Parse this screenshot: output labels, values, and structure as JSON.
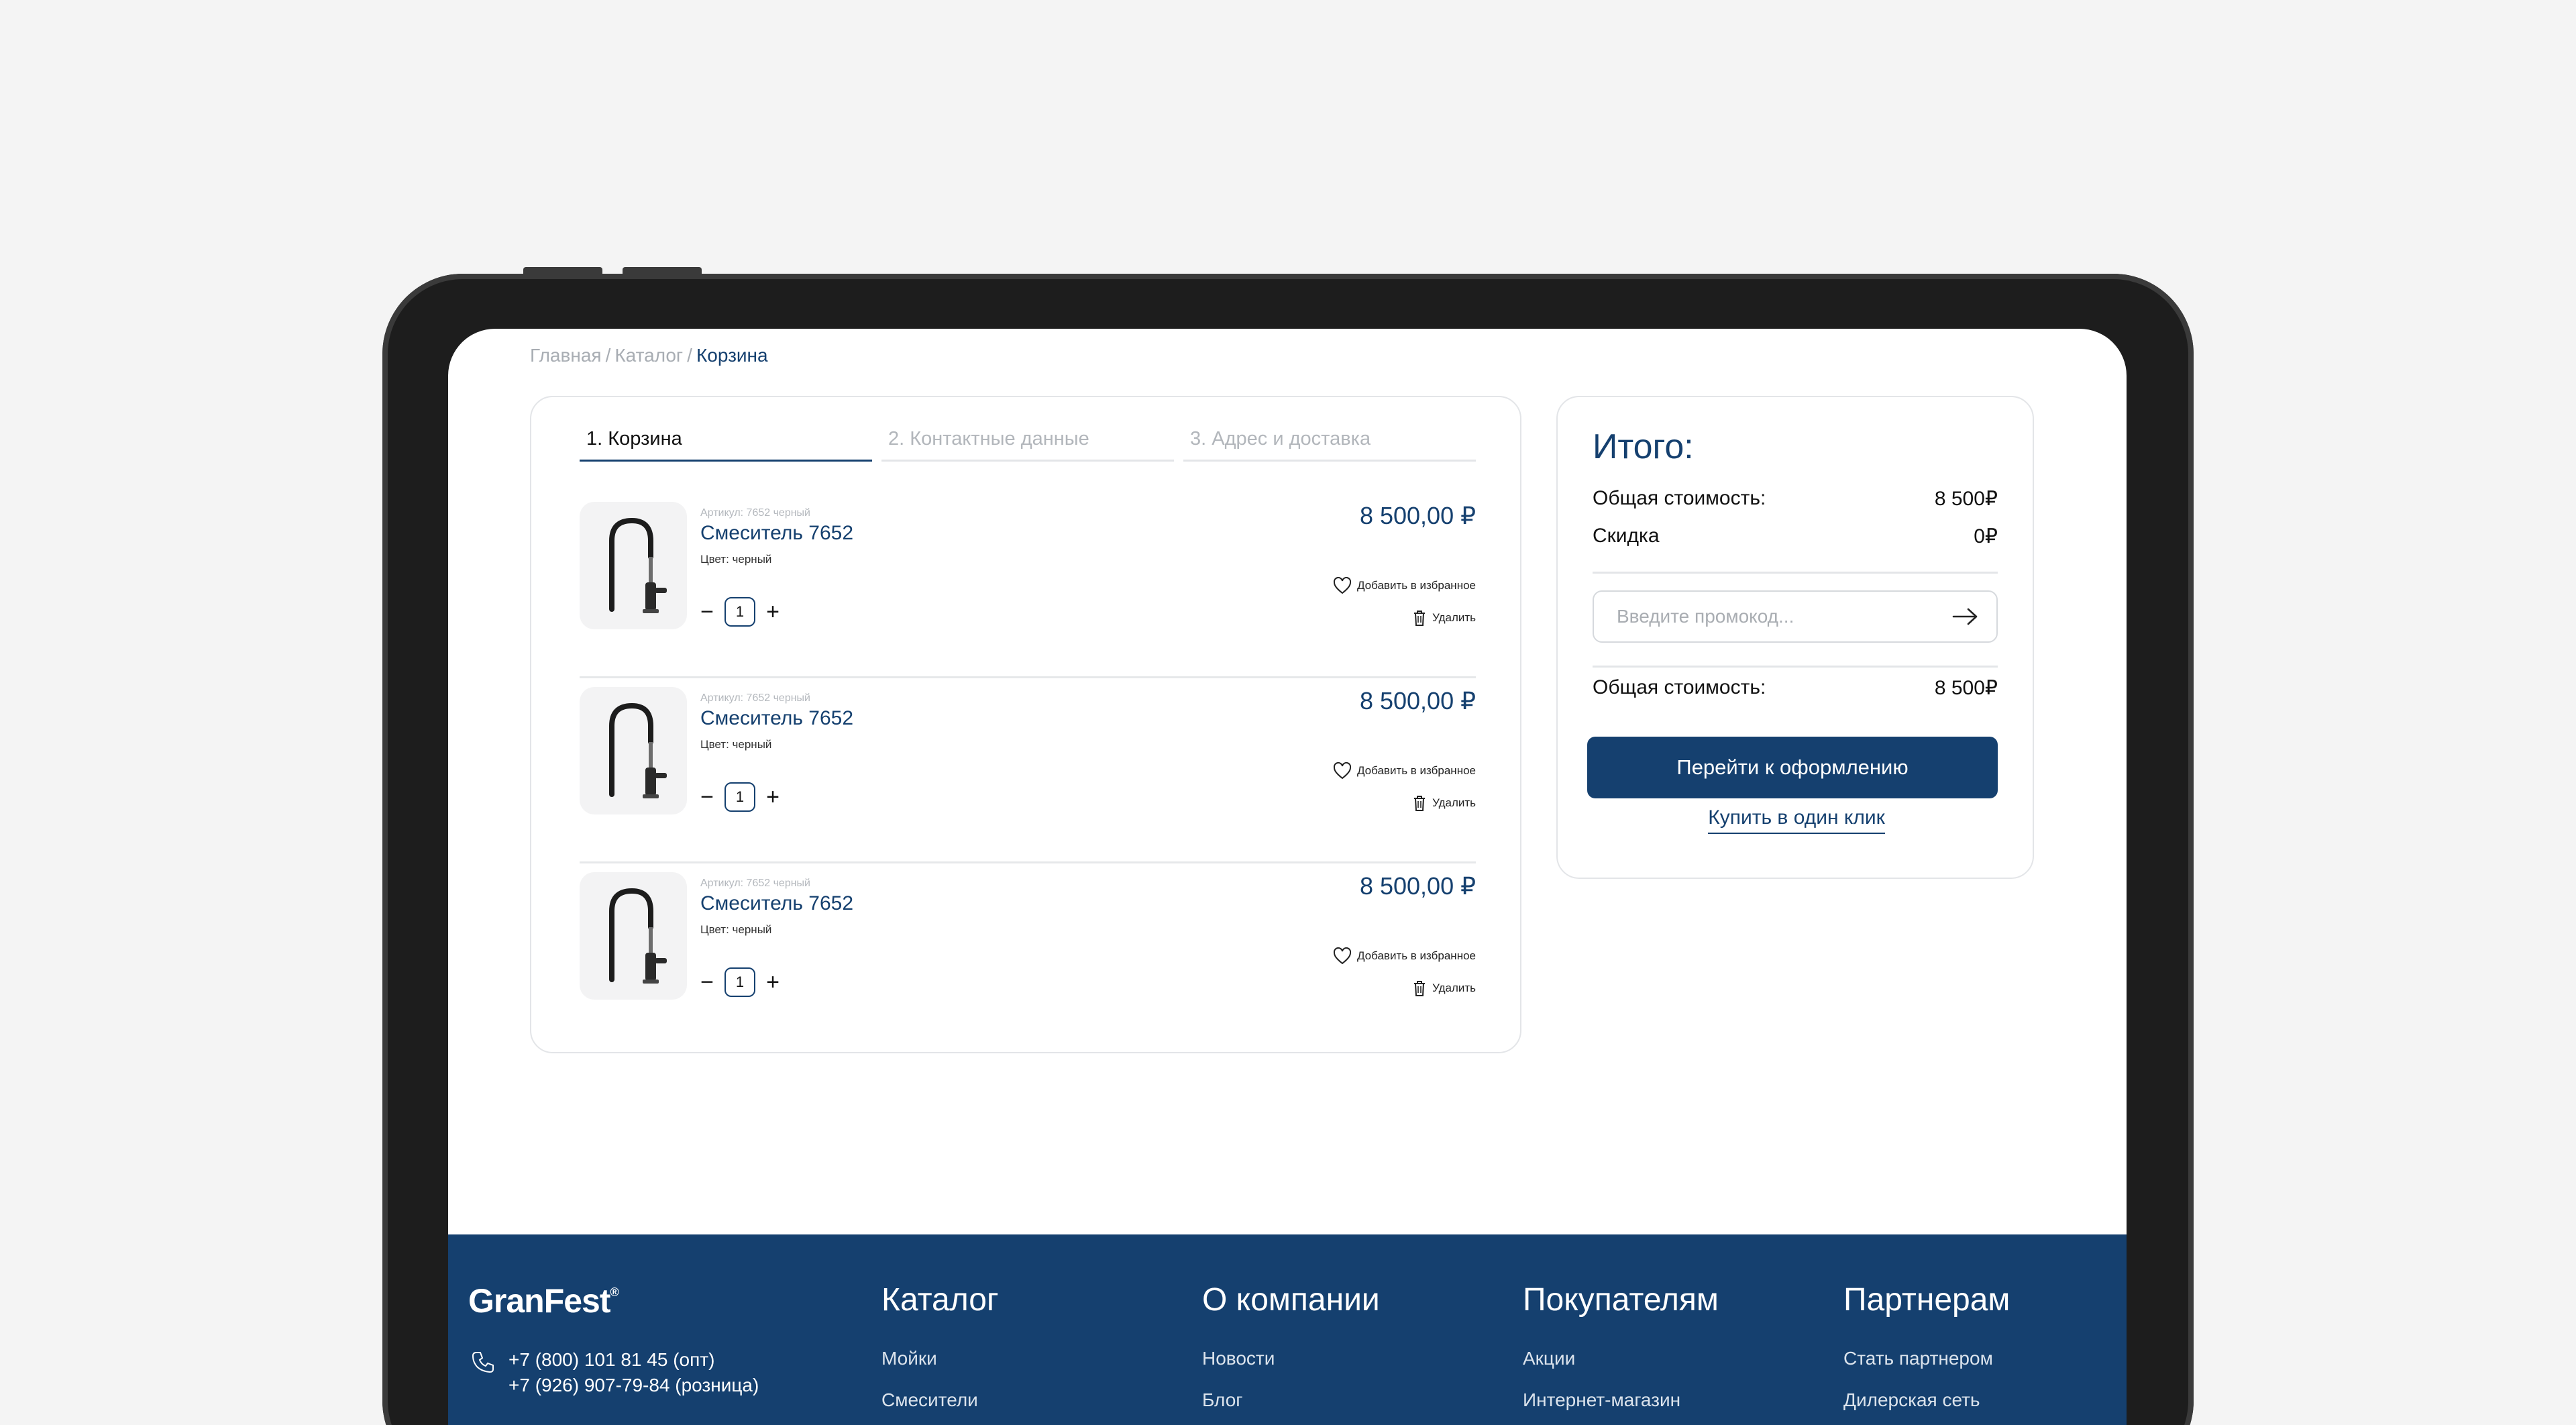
{
  "breadcrumb": {
    "home": "Главная",
    "catalog": "Каталог",
    "current": "Корзина",
    "sep": "/"
  },
  "steps": [
    "1. Корзина",
    "2. Контактные данные",
    "3. Адрес и доставка"
  ],
  "cart": {
    "items": [
      {
        "sku": "Артикул: 7652 черный",
        "name": "Смеситель 7652",
        "color": "Цвет: черный",
        "qty": "1",
        "price": "8 500,00 ₽",
        "fav": "Добавить в избранное",
        "delete": "Удалить",
        "minus": "−",
        "plus": "+"
      },
      {
        "sku": "Артикул: 7652 черный",
        "name": "Смеситель 7652",
        "color": "Цвет: черный",
        "qty": "1",
        "price": "8 500,00 ₽",
        "fav": "Добавить в избранное",
        "delete": "Удалить",
        "minus": "−",
        "plus": "+"
      },
      {
        "sku": "Артикул: 7652 черный",
        "name": "Смеситель 7652",
        "color": "Цвет: черный",
        "qty": "1",
        "price": "8 500,00 ₽",
        "fav": "Добавить в избранное",
        "delete": "Удалить",
        "minus": "−",
        "plus": "+"
      }
    ]
  },
  "summary": {
    "title": "Итого:",
    "subtotal_label": "Общая стоимость:",
    "subtotal_value": "8 500₽",
    "discount_label": "Скидка",
    "discount_value": "0₽",
    "promo_placeholder": "Введите промокод...",
    "total_label": "Общая стоимость:",
    "total_value": "8 500₽",
    "checkout": "Перейти к оформлению",
    "oneclick": "Купить в один клик"
  },
  "footer": {
    "logo": "GranFest",
    "logo_mark": "®",
    "phone_opt": "+7 (800) 101 81 45 (опт)",
    "phone_retail": "+7 (926) 907-79-84 (розница)",
    "columns": [
      {
        "title": "Каталог",
        "links": [
          "Мойки",
          "Смесители"
        ]
      },
      {
        "title": "О компании",
        "links": [
          "Новости",
          "Блог"
        ]
      },
      {
        "title": "Покупателям",
        "links": [
          "Акции",
          "Интернет-магазин"
        ]
      },
      {
        "title": "Партнерам",
        "links": [
          "Стать партнером",
          "Дилерская сеть"
        ]
      }
    ]
  },
  "colors": {
    "brand": "#15406f",
    "muted": "#a8adb3",
    "card_border": "#e3e5e8",
    "background": "#f4f4f4"
  },
  "icons": [
    "heart-icon",
    "trash-icon",
    "arrow-right-icon",
    "phone-icon"
  ]
}
